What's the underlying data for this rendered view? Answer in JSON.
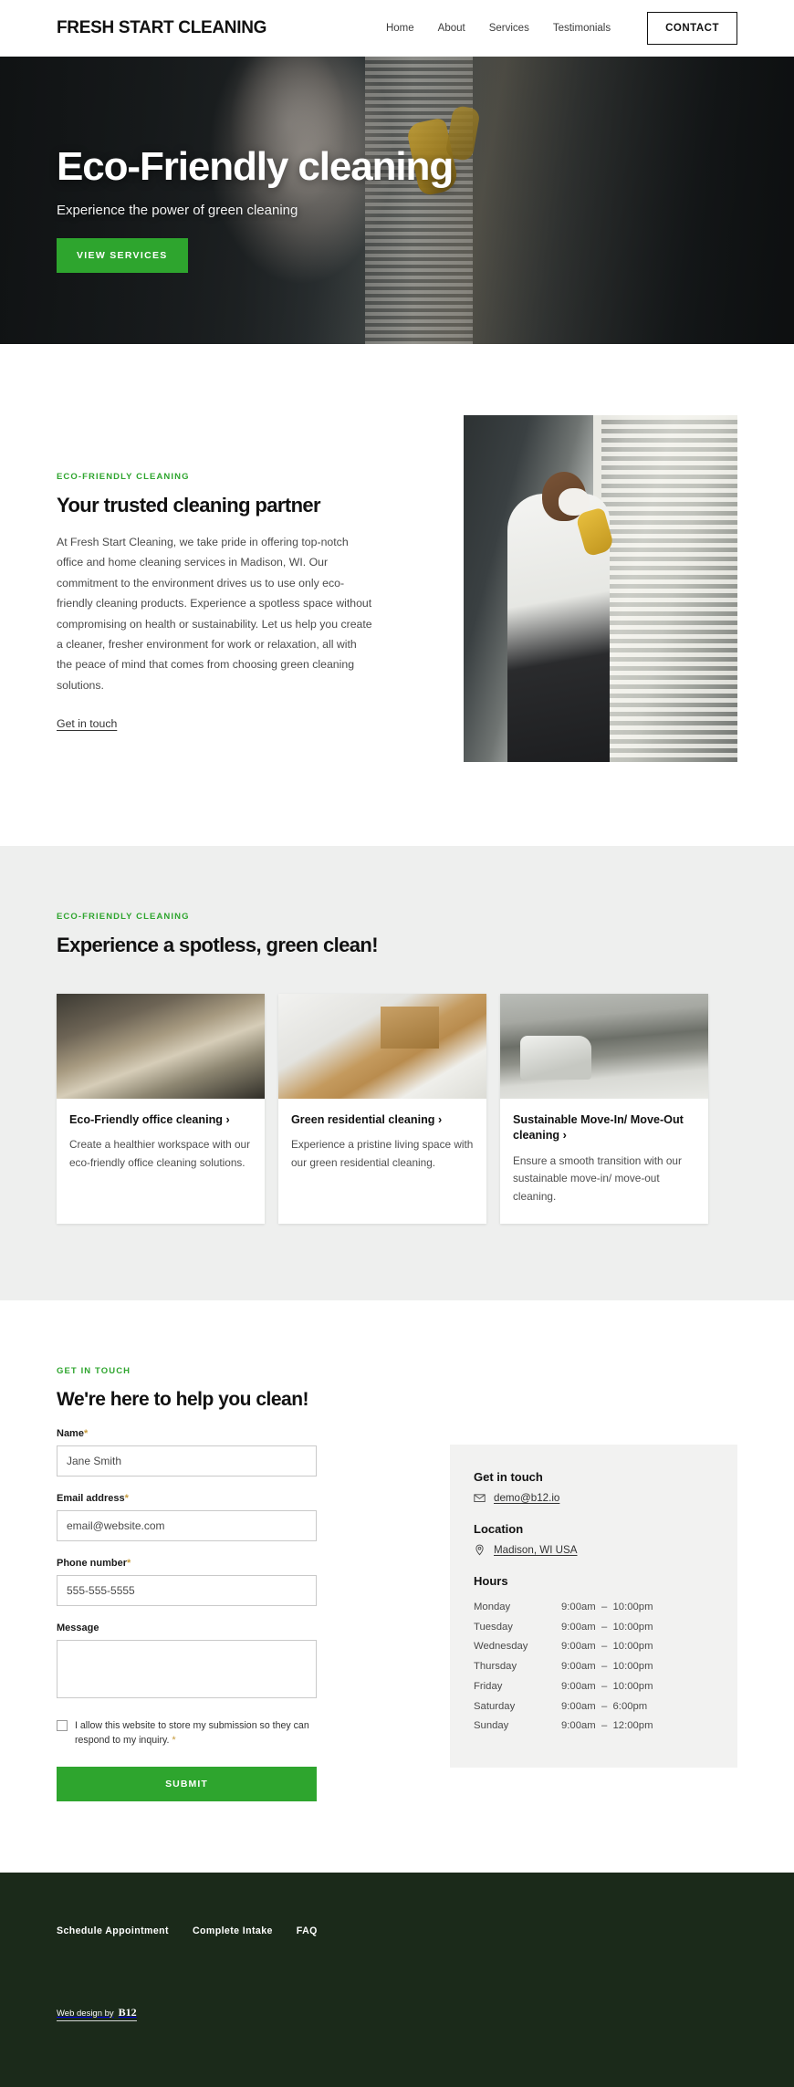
{
  "header": {
    "logo": "FRESH START CLEANING",
    "nav": [
      {
        "label": "Home"
      },
      {
        "label": "About"
      },
      {
        "label": "Services"
      },
      {
        "label": "Testimonials"
      }
    ],
    "contact_label": "CONTACT"
  },
  "hero": {
    "title": "Eco-Friendly cleaning",
    "subtitle": "Experience the power of green cleaning",
    "cta_label": "VIEW SERVICES",
    "accent_color": "#2ea52e"
  },
  "about": {
    "eyebrow": "ECO-FRIENDLY CLEANING",
    "title": "Your trusted cleaning partner",
    "body": "At Fresh Start Cleaning, we take pride in offering top-notch office and home cleaning services in Madison, WI. Our commitment to the environment drives us to use only eco-friendly cleaning products. Experience a spotless space without compromising on health or sustainability. Let us help you create a cleaner, fresher environment for work or relaxation, all with the peace of mind that comes from choosing green cleaning solutions.",
    "link_label": "Get in touch"
  },
  "services": {
    "eyebrow": "ECO-FRIENDLY CLEANING",
    "title": "Experience a spotless, green clean!",
    "cards": [
      {
        "title": "Eco-Friendly office cleaning ›",
        "text": "Create a healthier workspace with our eco-friendly office cleaning solutions."
      },
      {
        "title": "Green residential cleaning ›",
        "text": "Experience a pristine living space with our green residential cleaning."
      },
      {
        "title": "Sustainable Move-In/ Move-Out cleaning ›",
        "text": "Ensure a smooth transition with our sustainable move-in/ move-out cleaning."
      }
    ]
  },
  "contact": {
    "eyebrow": "GET IN TOUCH",
    "title": "We're here to help you clean!",
    "fields": {
      "name_label": "Name",
      "name_value": "Jane Smith",
      "email_label": "Email address",
      "email_value": "email@website.com",
      "phone_label": "Phone number",
      "phone_value": "555-555-5555",
      "message_label": "Message",
      "message_value": "",
      "required_marker": "*"
    },
    "consent_label": "I allow this website to store my submission so they can respond to my inquiry.",
    "submit_label": "SUBMIT",
    "info": {
      "get_in_touch_heading": "Get in touch",
      "email": "demo@b12.io",
      "location_heading": "Location",
      "location": "Madison, WI USA",
      "hours_heading": "Hours",
      "hours": [
        {
          "day": "Monday",
          "time": "9:00am  –  10:00pm"
        },
        {
          "day": "Tuesday",
          "time": "9:00am  –  10:00pm"
        },
        {
          "day": "Wednesday",
          "time": "9:00am  –  10:00pm"
        },
        {
          "day": "Thursday",
          "time": "9:00am  –  10:00pm"
        },
        {
          "day": "Friday",
          "time": "9:00am  –  10:00pm"
        },
        {
          "day": "Saturday",
          "time": "9:00am  –  6:00pm"
        },
        {
          "day": "Sunday",
          "time": "9:00am  –  12:00pm"
        }
      ]
    }
  },
  "footer": {
    "links": [
      {
        "label": "Schedule Appointment"
      },
      {
        "label": "Complete Intake"
      },
      {
        "label": "FAQ"
      }
    ],
    "credit_text": "Web design by",
    "credit_logo": "B12",
    "background_color": "#1b2a1a"
  }
}
